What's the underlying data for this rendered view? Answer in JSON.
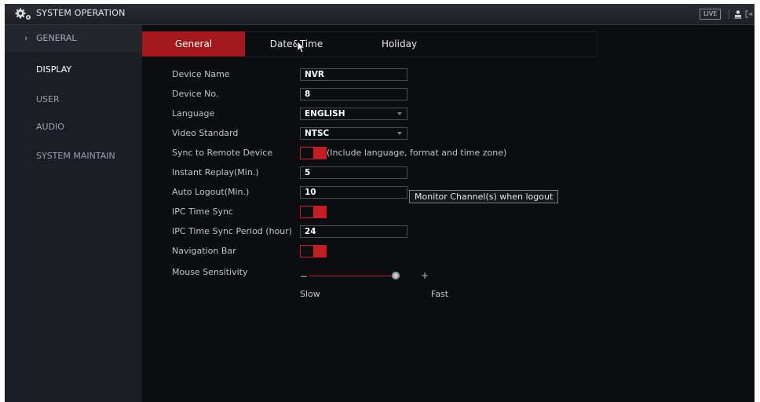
{
  "window": {
    "title": "SYSTEM OPERATION",
    "live_label": "LIVE",
    "icons": [
      "gears-icon",
      "user-icon",
      "logout-icon"
    ]
  },
  "sidebar": {
    "items": [
      {
        "label": "GENERAL",
        "selected": true
      },
      {
        "label": "DISPLAY"
      },
      {
        "label": "USER"
      },
      {
        "label": "AUDIO"
      },
      {
        "label": "SYSTEM MAINTAIN"
      }
    ]
  },
  "tabs": [
    {
      "label": "General",
      "active": true
    },
    {
      "label": "Date&Time"
    },
    {
      "label": "Holiday"
    }
  ],
  "form": {
    "device_name": {
      "label": "Device Name",
      "value": "NVR"
    },
    "device_no": {
      "label": "Device No.",
      "value": "8"
    },
    "language": {
      "label": "Language",
      "value": "ENGLISH"
    },
    "video_standard": {
      "label": "Video Standard",
      "value": "NTSC"
    },
    "sync_remote": {
      "label": "Sync to Remote Device",
      "note": "(Include language, format and time zone)",
      "enabled": true
    },
    "instant_replay": {
      "label": "Instant Replay(Min.)",
      "value": "5"
    },
    "auto_logout": {
      "label": "Auto Logout(Min.)",
      "value": "10",
      "button": "Monitor Channel(s) when logout"
    },
    "ipc_time_sync": {
      "label": "IPC Time Sync",
      "enabled": true
    },
    "ipc_sync_period": {
      "label": "IPC Time Sync Period (hour)",
      "value": "24"
    },
    "navigation_bar": {
      "label": "Navigation Bar",
      "enabled": true
    },
    "mouse_sensitivity": {
      "label": "Mouse Sensitivity",
      "minus": "−",
      "plus": "+",
      "slow": "Slow",
      "fast": "Fast",
      "level": 1.0
    }
  },
  "colors": {
    "accent": "#c41d24",
    "tab_active": "#a3171d",
    "background": "#0c0d10",
    "sidebar": "#1b1e24"
  }
}
